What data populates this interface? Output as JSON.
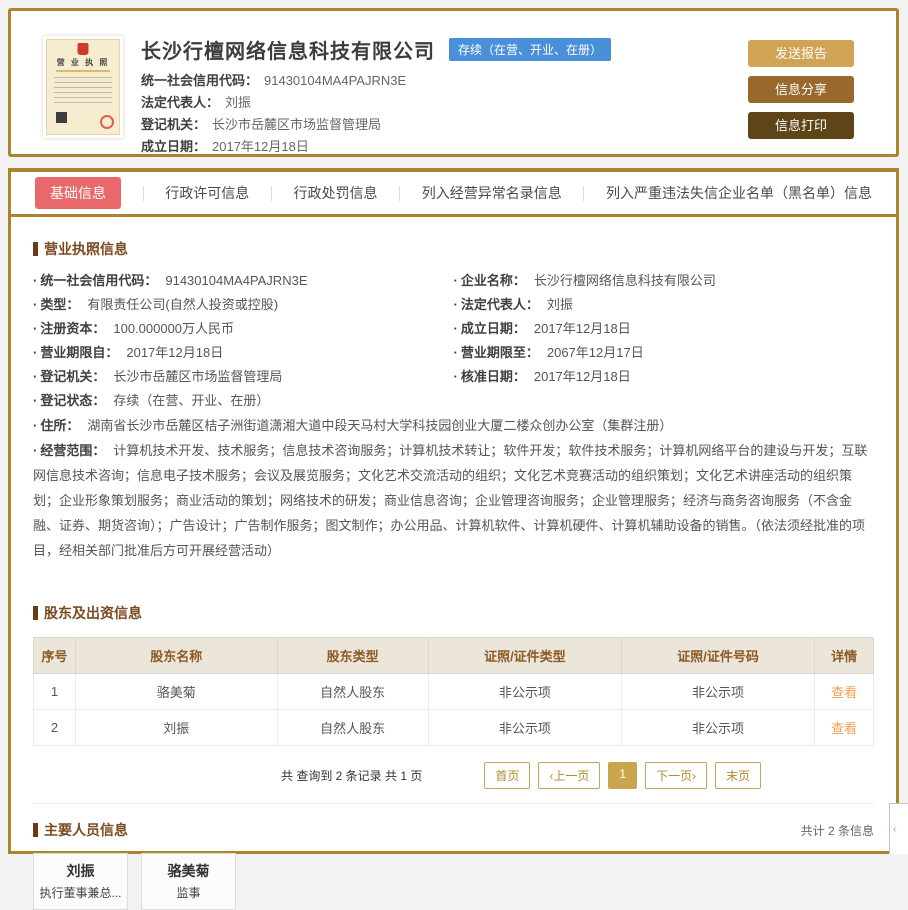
{
  "header": {
    "company_name": "长沙行檀网络信息科技有限公司",
    "status_badge": "存续（在营、开业、在册）",
    "license_title": "营 业 执 照",
    "fields": [
      {
        "label": "统一社会信用代码：",
        "value": "91430104MA4PAJRN3E"
      },
      {
        "label": "法定代表人：",
        "value": "刘振"
      },
      {
        "label": "登记机关：",
        "value": "长沙市岳麓区市场监督管理局"
      },
      {
        "label": "成立日期：",
        "value": "2017年12月18日"
      }
    ],
    "buttons": [
      {
        "label": "发送报告",
        "color": "#d0a355"
      },
      {
        "label": "信息分享",
        "color": "#99682c"
      },
      {
        "label": "信息打印",
        "color": "#5e4517"
      }
    ]
  },
  "tabs": [
    {
      "label": "基础信息",
      "active": true
    },
    {
      "label": "行政许可信息",
      "active": false
    },
    {
      "label": "行政处罚信息",
      "active": false
    },
    {
      "label": "列入经营异常名录信息",
      "active": false
    },
    {
      "label": "列入严重违法失信企业名单（黑名单）信息",
      "active": false
    }
  ],
  "license_section": {
    "title": "营业执照信息",
    "bullet": "·",
    "left_fields": [
      {
        "label": "统一社会信用代码：",
        "value": "91430104MA4PAJRN3E"
      },
      {
        "label": "类型：",
        "value": "有限责任公司(自然人投资或控股)"
      },
      {
        "label": "注册资本：",
        "value": "100.000000万人民币"
      },
      {
        "label": "营业期限自：",
        "value": "2017年12月18日"
      },
      {
        "label": "登记机关：",
        "value": "长沙市岳麓区市场监督管理局"
      },
      {
        "label": "登记状态：",
        "value": "存续（在营、开业、在册）"
      }
    ],
    "right_fields": [
      {
        "label": "企业名称：",
        "value": "长沙行檀网络信息科技有限公司"
      },
      {
        "label": "法定代表人：",
        "value": "刘振"
      },
      {
        "label": "成立日期：",
        "value": "2017年12月18日"
      },
      {
        "label": "营业期限至：",
        "value": "2067年12月17日"
      },
      {
        "label": "核准日期：",
        "value": "2017年12月18日"
      }
    ],
    "full_fields": [
      {
        "label": "住所：",
        "value": "湖南省长沙市岳麓区桔子洲街道潇湘大道中段天马村大学科技园创业大厦二楼众创办公室（集群注册）"
      },
      {
        "label": "经营范围：",
        "value": "计算机技术开发、技术服务；信息技术咨询服务；计算机技术转让；软件开发；软件技术服务；计算机网络平台的建设与开发；互联网信息技术咨询；信息电子技术服务；会议及展览服务；文化艺术交流活动的组织；文化艺术竞赛活动的组织策划；文化艺术讲座活动的组织策划；企业形象策划服务；商业活动的策划；网络技术的研发；商业信息咨询；企业管理咨询服务；企业管理服务；经济与商务咨询服务（不含金融、证券、期货咨询）；广告设计；广告制作服务；图文制作；办公用品、计算机软件、计算机硬件、计算机辅助设备的销售。（依法须经批准的项目，经相关部门批准后方可开展经营活动）"
      }
    ]
  },
  "shareholders_section": {
    "title": "股东及出资信息",
    "columns": [
      "序号",
      "股东名称",
      "股东类型",
      "证照/证件类型",
      "证照/证件号码",
      "详情"
    ],
    "rows": [
      [
        "1",
        "骆美菊",
        "自然人股东",
        "非公示项",
        "非公示项"
      ],
      [
        "2",
        "刘振",
        "自然人股东",
        "非公示项",
        "非公示项"
      ]
    ],
    "detail_link": "查看",
    "summary": "共 查询到 2 条记录 共 1 页",
    "pagination": {
      "first": "首页",
      "prev": "‹上一页",
      "page": "1",
      "next": "下一页›",
      "last": "末页"
    }
  },
  "staff_section": {
    "title": "主要人员信息",
    "count_text": "共计 2 条信息",
    "people": [
      {
        "name": "刘振",
        "role": "执行董事兼总..."
      },
      {
        "name": "骆美菊",
        "role": "监事"
      }
    ]
  },
  "colors": {
    "gold_border": "#ab842d",
    "active_tab": "#e9686b",
    "status_badge_blue": "#4a90d9",
    "section_title_brown": "#7a4a21",
    "view_link_orange": "#f0a055"
  }
}
